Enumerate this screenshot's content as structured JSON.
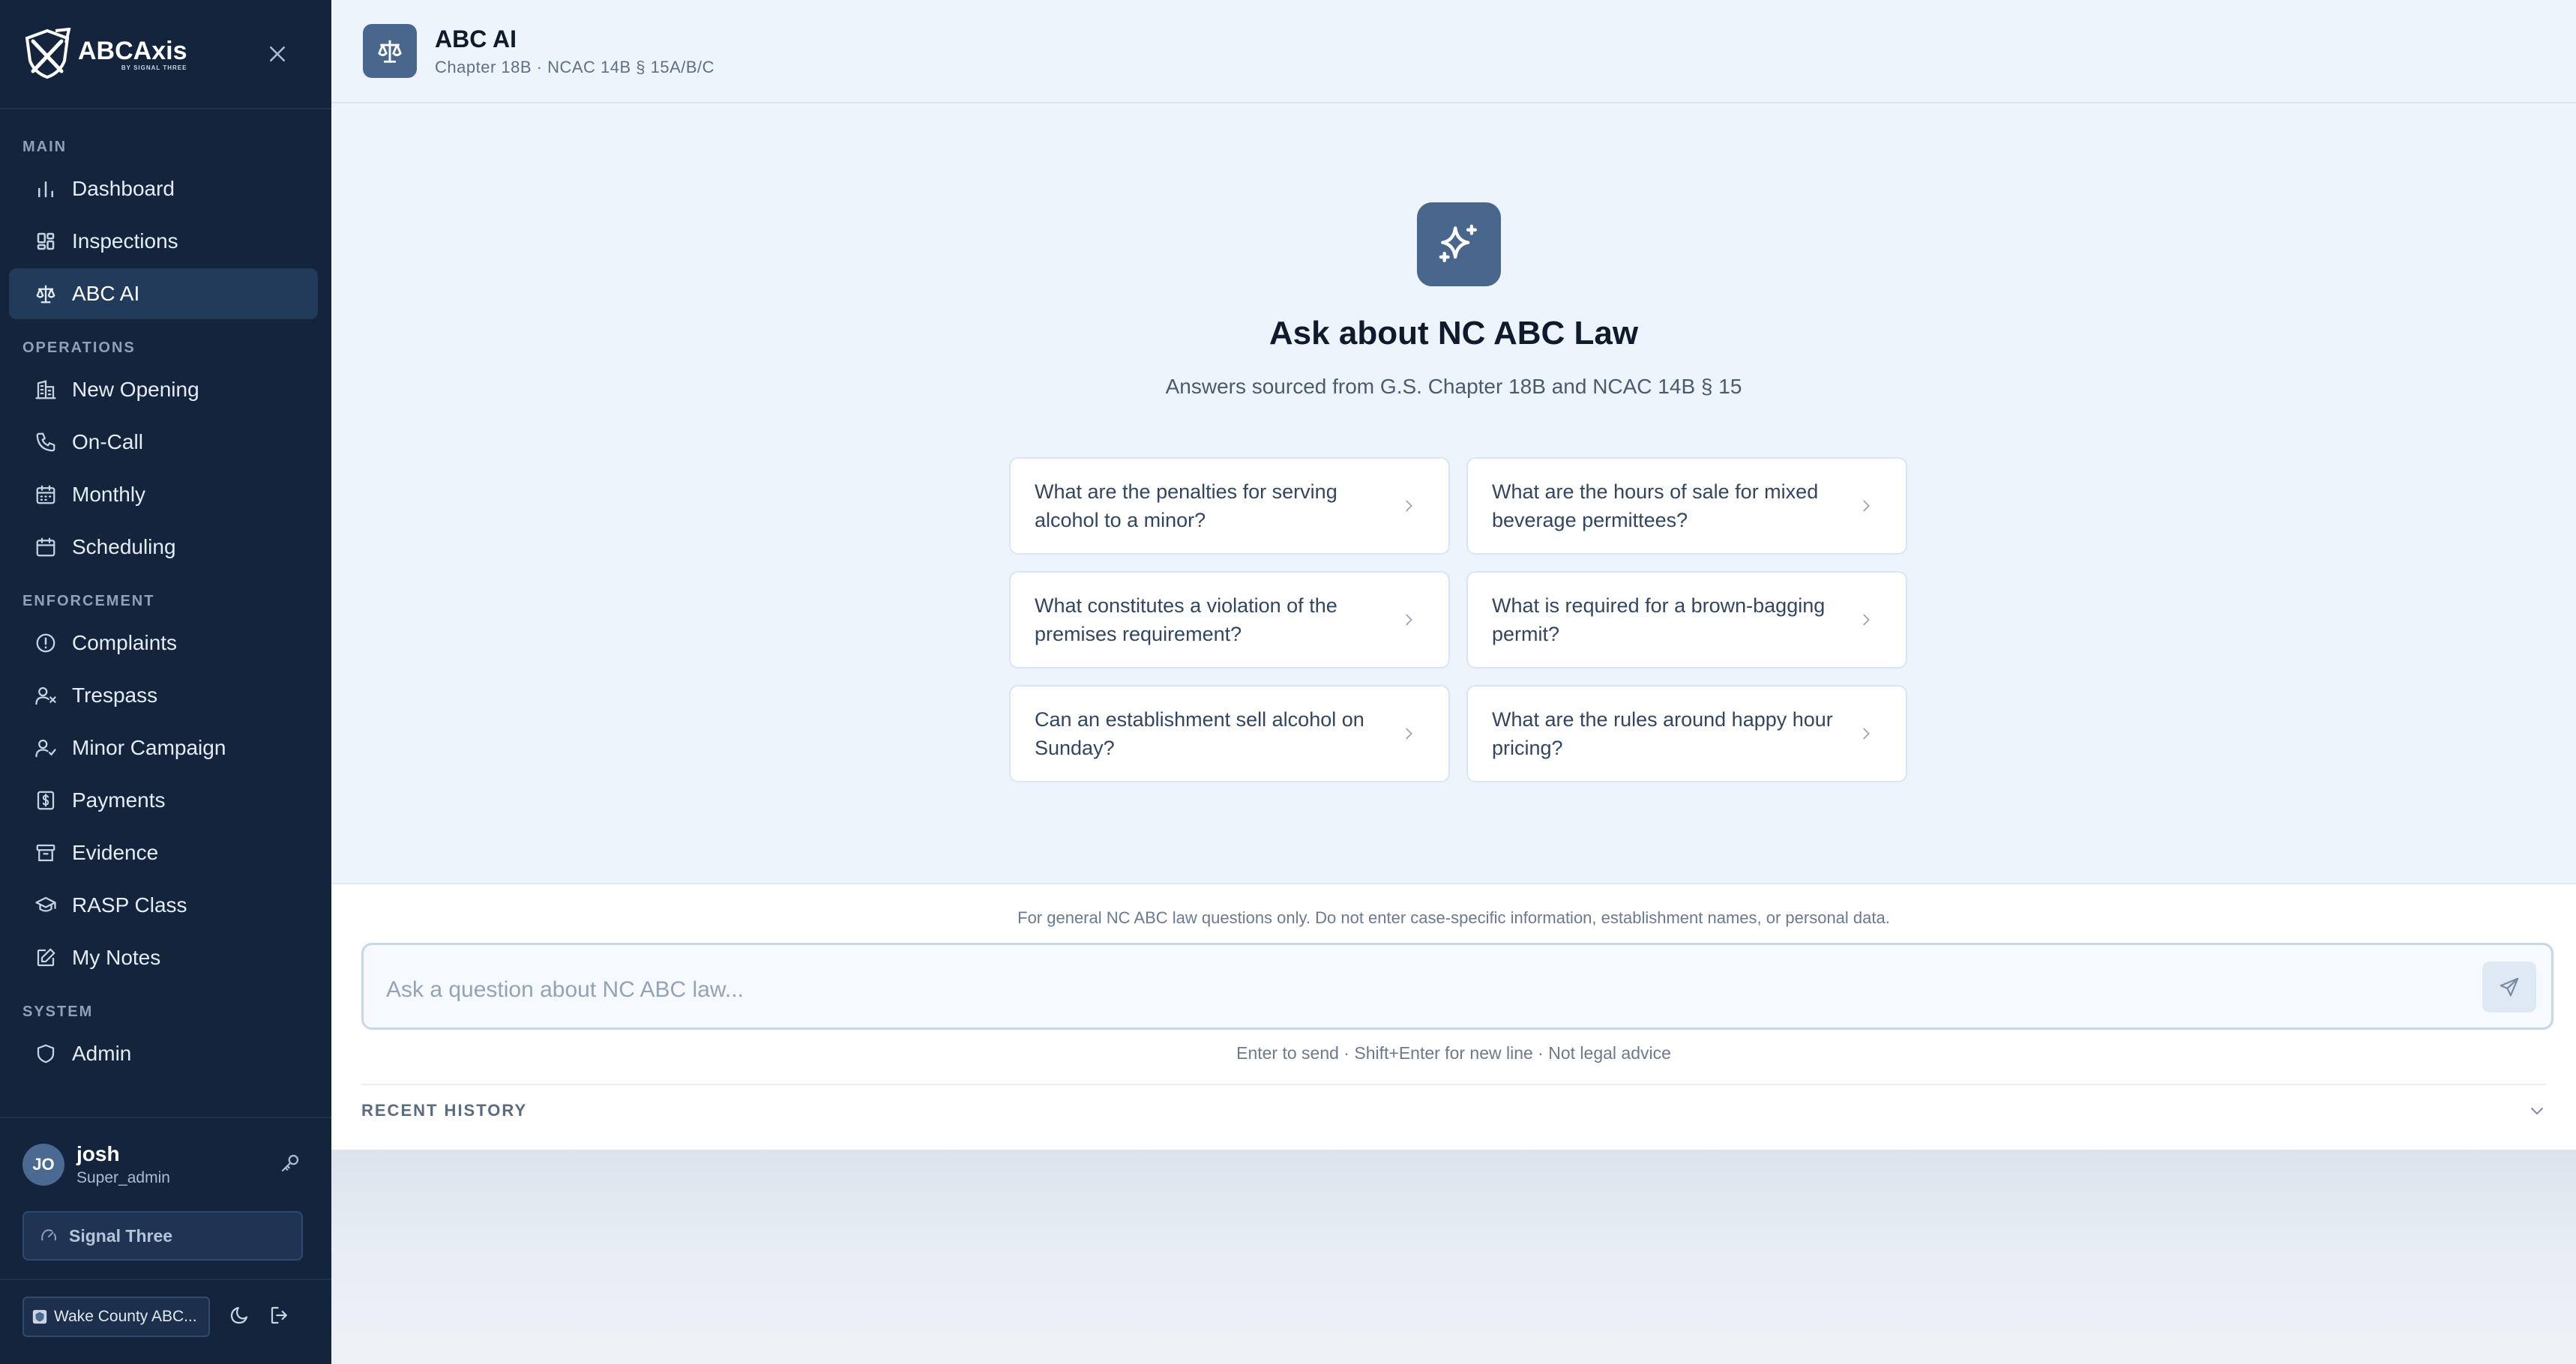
{
  "brand": {
    "logo_text": "ABCAxis",
    "logo_subtext": "BY SIGNAL THREE"
  },
  "sidebar": {
    "sections": [
      {
        "label": "MAIN",
        "items": [
          {
            "label": "Dashboard",
            "icon": "bar-chart-icon"
          },
          {
            "label": "Inspections",
            "icon": "grid-icon"
          },
          {
            "label": "ABC AI",
            "icon": "scale-icon",
            "active": true
          }
        ]
      },
      {
        "label": "OPERATIONS",
        "items": [
          {
            "label": "New Opening",
            "icon": "building-icon"
          },
          {
            "label": "On-Call",
            "icon": "phone-icon"
          },
          {
            "label": "Monthly",
            "icon": "calendar-days-icon"
          },
          {
            "label": "Scheduling",
            "icon": "calendar-icon"
          }
        ]
      },
      {
        "label": "ENFORCEMENT",
        "items": [
          {
            "label": "Complaints",
            "icon": "alert-circle-icon"
          },
          {
            "label": "Trespass",
            "icon": "user-x-icon"
          },
          {
            "label": "Minor Campaign",
            "icon": "user-check-icon"
          },
          {
            "label": "Payments",
            "icon": "dollar-icon"
          },
          {
            "label": "Evidence",
            "icon": "archive-icon"
          },
          {
            "label": "RASP Class",
            "icon": "graduation-cap-icon"
          },
          {
            "label": "My Notes",
            "icon": "note-edit-icon"
          }
        ]
      },
      {
        "label": "SYSTEM",
        "items": [
          {
            "label": "Admin",
            "icon": "shield-icon"
          }
        ]
      }
    ],
    "user": {
      "initials": "JO",
      "name": "josh",
      "role": "Super_admin"
    },
    "org_button": "Signal Three",
    "county_button": "Wake County ABC..."
  },
  "header": {
    "title": "ABC AI",
    "subtitle": "Chapter 18B · NCAC 14B § 15A/B/C"
  },
  "hero": {
    "title": "Ask about NC ABC Law",
    "subtitle": "Answers sourced from G.S. Chapter 18B and NCAC 14B § 15"
  },
  "suggestions": [
    "What are the penalties for serving alcohol to a minor?",
    "What are the hours of sale for mixed beverage permittees?",
    "What constitutes a violation of the premises requirement?",
    "What is required for a brown-bagging permit?",
    "Can an establishment sell alcohol on Sunday?",
    "What are the rules around happy hour pricing?"
  ],
  "composer": {
    "disclaimer": "For general NC ABC law questions only. Do not enter case-specific information, establishment names, or personal data.",
    "placeholder": "Ask a question about NC ABC law...",
    "value": "",
    "hint": "Enter to send · Shift+Enter for new line · Not legal advice",
    "history_label": "RECENT HISTORY"
  },
  "colors": {
    "sidebar_bg": "#13243c",
    "sidebar_active": "#233b5a",
    "accent": "#49678d",
    "main_bg": "#eef4fb"
  }
}
